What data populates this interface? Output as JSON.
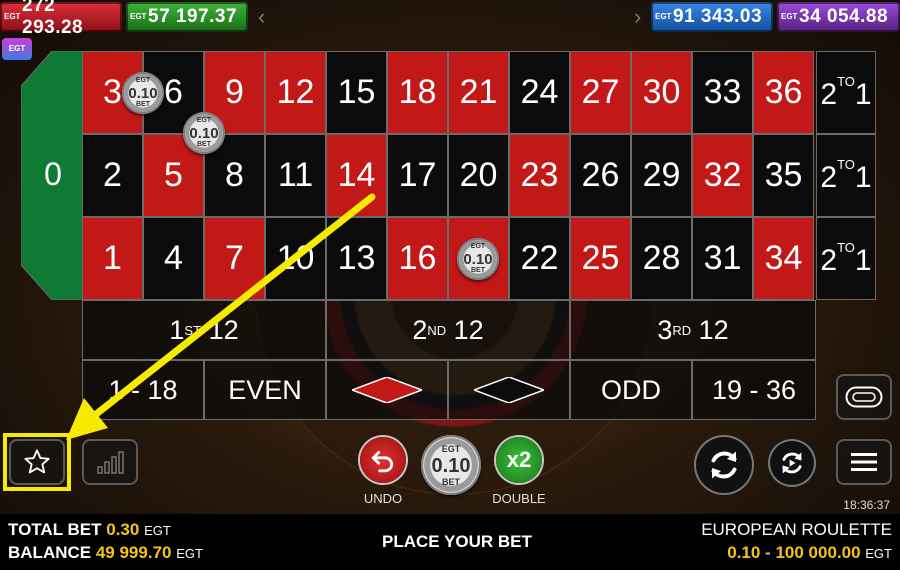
{
  "jackpots": [
    {
      "brand": "EGT",
      "value": "272 293.28",
      "color": "#c8202a"
    },
    {
      "brand": "EGT",
      "value": "57 197.37",
      "color": "#2f9a2b"
    },
    {
      "brand": "EGT",
      "value": "91 343.03",
      "color": "#236cc8"
    },
    {
      "brand": "EGT",
      "value": "34 054.88",
      "color": "#7b36b6"
    }
  ],
  "nav_arrows": {
    "left": "‹",
    "right": "›"
  },
  "logo": "EGT",
  "table": {
    "zero": "0",
    "rows": [
      [
        "3",
        "6",
        "9",
        "12",
        "15",
        "18",
        "21",
        "24",
        "27",
        "30",
        "33",
        "36"
      ],
      [
        "2",
        "5",
        "8",
        "11",
        "14",
        "17",
        "20",
        "23",
        "26",
        "29",
        "32",
        "35"
      ],
      [
        "1",
        "4",
        "7",
        "10",
        "13",
        "16",
        "19",
        "22",
        "25",
        "28",
        "31",
        "34"
      ]
    ],
    "row_colors": [
      [
        "red",
        "black",
        "red",
        "red",
        "black",
        "red",
        "red",
        "black",
        "red",
        "red",
        "black",
        "red"
      ],
      [
        "black",
        "red",
        "black",
        "black",
        "red",
        "black",
        "black",
        "red",
        "black",
        "black",
        "red",
        "black"
      ],
      [
        "red",
        "black",
        "red",
        "black",
        "black",
        "red",
        "red",
        "black",
        "red",
        "black",
        "black",
        "red"
      ]
    ],
    "column_bet": {
      "pre": "2",
      "sup": "TO",
      "post": "1"
    },
    "dozens": [
      {
        "num": "1",
        "sup": "ST",
        "val": "12"
      },
      {
        "num": "2",
        "sup": "ND",
        "val": "12"
      },
      {
        "num": "3",
        "sup": "RD",
        "val": "12"
      }
    ],
    "outside": [
      "1 - 18",
      "EVEN",
      "",
      "",
      "ODD",
      "19 - 36"
    ]
  },
  "chip": {
    "brand": "EGT",
    "value": "0.10",
    "unit": "BET"
  },
  "controls": {
    "undo_label": "UNDO",
    "double_label": "DOUBLE",
    "double_value": "x2"
  },
  "clock": "18:36:37",
  "footer": {
    "total_bet_label": "TOTAL BET",
    "total_bet_value": "0.30",
    "total_bet_currency": "EGT",
    "balance_label": "BALANCE",
    "balance_value": "49 999.70",
    "balance_currency": "EGT",
    "status": "PLACE YOUR BET",
    "game_name": "EUROPEAN ROULETTE",
    "limits": "0.10 - 100 000.00",
    "limits_currency": "EGT"
  },
  "colors": {
    "accent_yellow": "#f5ea00",
    "felt_green": "#0f7a33",
    "table_red": "#c21818"
  }
}
